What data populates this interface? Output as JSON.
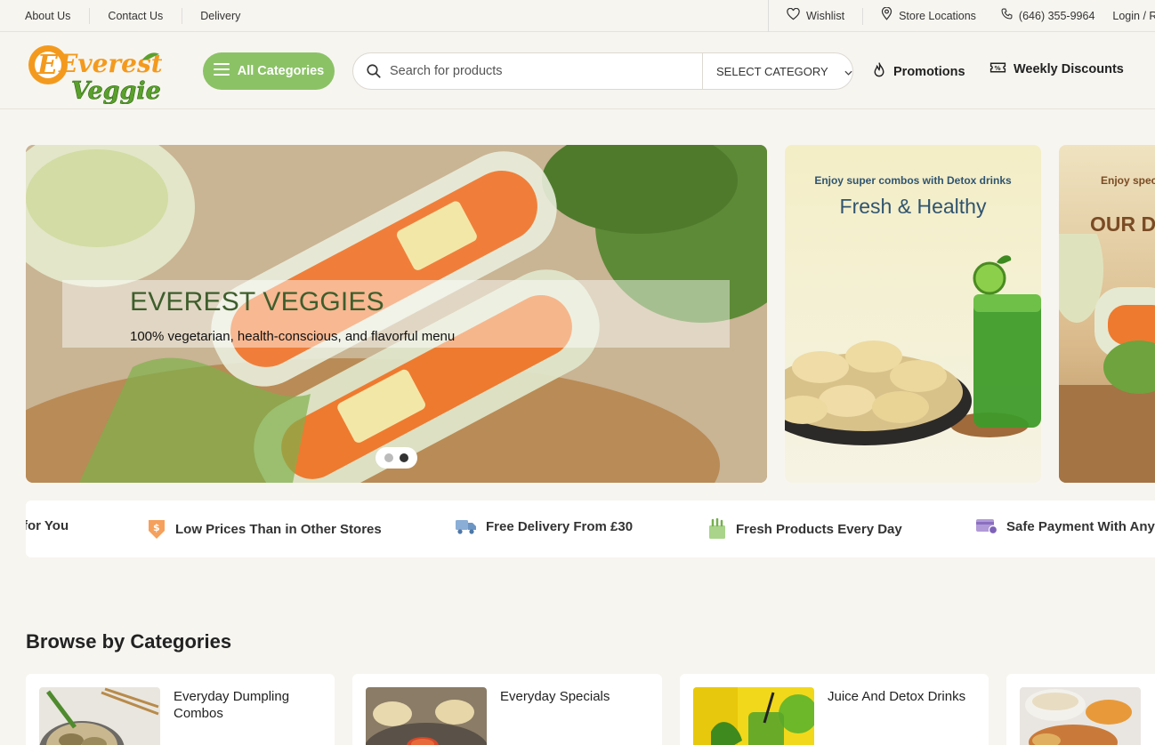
{
  "topbar": {
    "links": [
      "About Us",
      "Contact Us",
      "Delivery"
    ],
    "wishlist": "Wishlist",
    "store_locations": "Store Locations",
    "phone": "(646) 355-9964",
    "login": "Login / R"
  },
  "header": {
    "logo_line1": "Everest",
    "logo_line2": "Veggie",
    "all_categories": "All Categories",
    "search_placeholder": "Search for products",
    "select_category": "SELECT CATEGORY",
    "promotions": "Promotions",
    "weekly_discounts": "Weekly Discounts"
  },
  "hero": {
    "title": "EVEREST VEGGIES",
    "subtitle": "100% vegetarian, health-conscious, and flavorful menu",
    "slides_total": 2,
    "slide_active": 2
  },
  "promos": [
    {
      "small": "Enjoy super combos with Detox drinks",
      "big": "Fresh & Healthy"
    },
    {
      "small": "Enjoy spec",
      "big": "OUR DA"
    }
  ],
  "features": [
    "for You",
    "Low Prices Than in Other Stores",
    "Free Delivery From £30",
    "Fresh Products Every Day",
    "Safe Payment With Any"
  ],
  "categories": {
    "title": "Browse by Categories",
    "items": [
      "Everyday Dumpling Combos",
      "Everyday Specials",
      "Juice And Detox Drinks",
      ""
    ]
  },
  "colors": {
    "accent_green": "#8bc266",
    "logo_orange": "#f39a1e",
    "logo_green": "#5aa02c",
    "promo_blue": "#2f5470"
  }
}
